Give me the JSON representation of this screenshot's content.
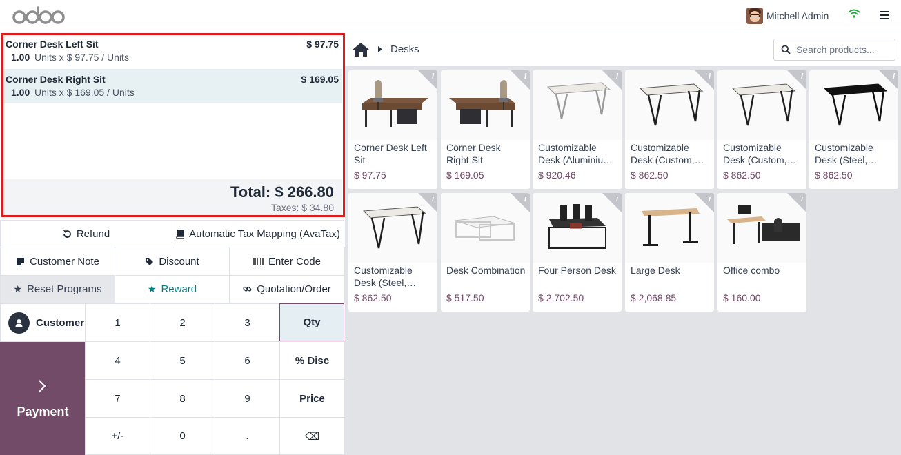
{
  "header": {
    "logo": "odoo",
    "user_name": "Mitchell Admin"
  },
  "order": {
    "lines": [
      {
        "name": "Corner Desk Left Sit",
        "price": "$ 97.75",
        "qty": "1.00",
        "detail": "Units x $ 97.75 / Units"
      },
      {
        "name": "Corner Desk Right Sit",
        "price": "$ 169.05",
        "qty": "1.00",
        "detail": "Units x $ 169.05 / Units"
      }
    ],
    "total": "Total: $ 266.80",
    "taxes": "Taxes: $ 34.80"
  },
  "controls": {
    "refund": "Refund",
    "tax_mapping": "Automatic Tax Mapping (AvaTax)",
    "customer_note": "Customer Note",
    "discount": "Discount",
    "enter_code": "Enter Code",
    "reset_programs": "Reset Programs",
    "reward": "Reward",
    "quotation": "Quotation/Order"
  },
  "numpad": {
    "customer": "Customer",
    "payment": "Payment",
    "keys": [
      "1",
      "2",
      "3",
      "Qty",
      "4",
      "5",
      "6",
      "% Disc",
      "7",
      "8",
      "9",
      "Price",
      "+/-",
      "0",
      ".",
      "⌫"
    ]
  },
  "products_bar": {
    "breadcrumb": "Desks",
    "search_placeholder": "Search products..."
  },
  "products": [
    {
      "name": "Corner Desk Left Sit",
      "price": "$ 97.75"
    },
    {
      "name": "Corner Desk Right Sit",
      "price": "$ 169.05"
    },
    {
      "name": "Customizable Desk (Aluminiu…",
      "price": "$ 920.46"
    },
    {
      "name": "Customizable Desk (Custom,…",
      "price": "$ 862.50"
    },
    {
      "name": "Customizable Desk (Custom,…",
      "price": "$ 862.50"
    },
    {
      "name": "Customizable Desk (Steel,…",
      "price": "$ 862.50"
    },
    {
      "name": "Customizable Desk (Steel,…",
      "price": "$ 862.50"
    },
    {
      "name": "Desk Combination",
      "price": "$ 517.50"
    },
    {
      "name": "Four Person Desk",
      "price": "$ 2,702.50"
    },
    {
      "name": "Large Desk",
      "price": "$ 2,068.85"
    },
    {
      "name": "Office combo",
      "price": "$ 160.00"
    }
  ],
  "colors": {
    "brand": "#714b67",
    "accent": "#017e84",
    "highlight_border": "#e01b1b"
  }
}
